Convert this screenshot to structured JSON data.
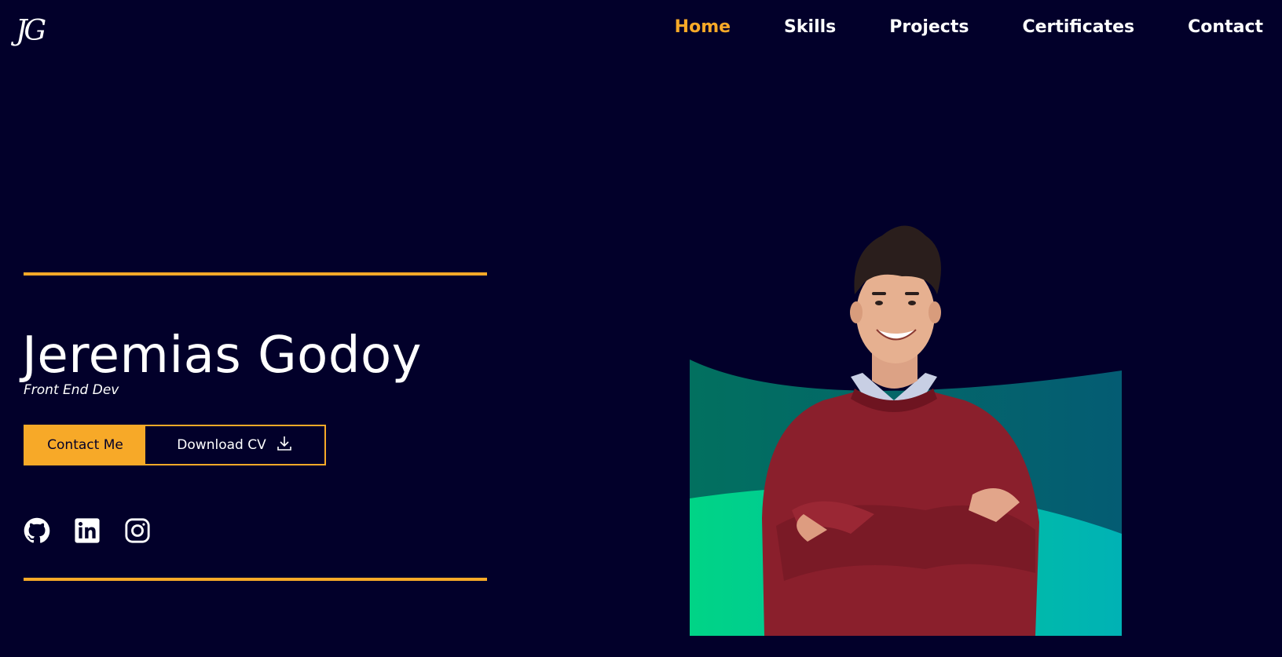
{
  "header": {
    "logo": "JG",
    "nav": [
      "Home",
      "Skills",
      "Projects",
      "Certificates",
      "Contact"
    ],
    "active": "Home"
  },
  "hero": {
    "name": "Jeremias Godoy",
    "role": "Front End Dev",
    "contact_button": "Contact Me",
    "download_button": "Download CV",
    "socials": [
      "github-icon",
      "linkedin-icon",
      "instagram-icon"
    ],
    "colors": {
      "accent": "#f7a928",
      "background": "#02002a",
      "sweater": "#8a1f2c",
      "green": "#00d486",
      "teal": "#005f73"
    }
  }
}
